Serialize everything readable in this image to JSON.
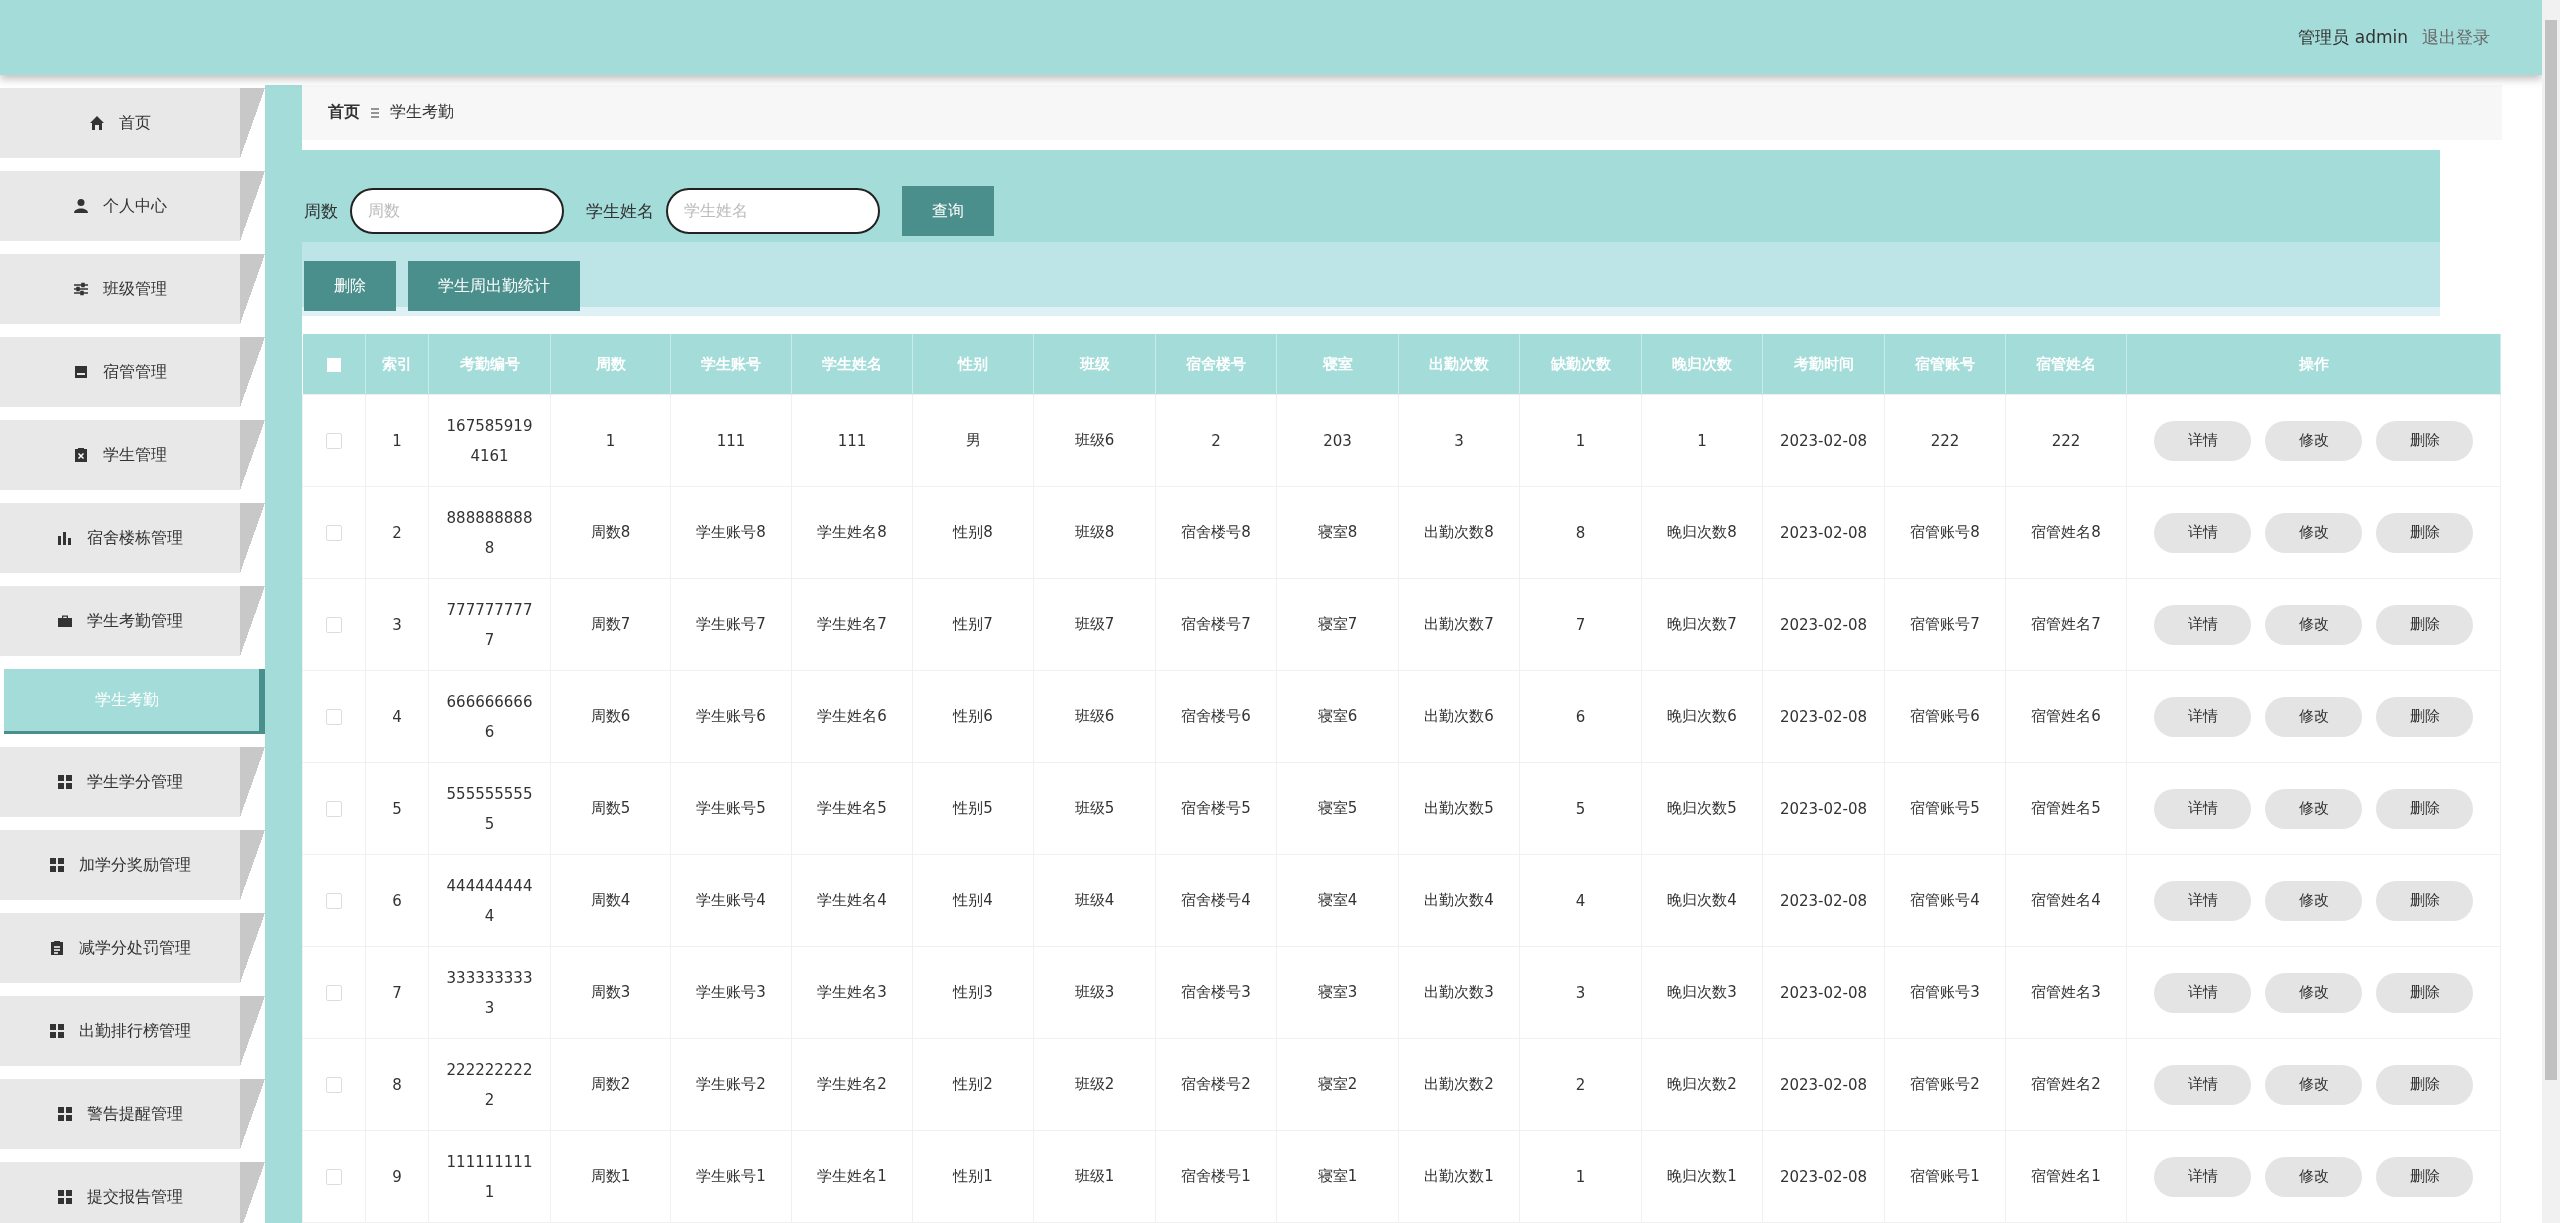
{
  "header": {
    "user": "管理员 admin",
    "logout": "退出登录"
  },
  "sidebar": {
    "items": [
      {
        "label": "首页",
        "selected": false
      },
      {
        "label": "个人中心",
        "selected": false
      },
      {
        "label": "班级管理",
        "selected": false
      },
      {
        "label": "宿管管理",
        "selected": false
      },
      {
        "label": "学生管理",
        "selected": false
      },
      {
        "label": "宿舍楼栋管理",
        "selected": false
      },
      {
        "label": "学生考勤管理",
        "selected": false,
        "expanded": true,
        "children": [
          {
            "label": "学生考勤",
            "selected": true
          }
        ]
      },
      {
        "label": "学生学分管理",
        "selected": false
      },
      {
        "label": "加学分奖励管理",
        "selected": false
      },
      {
        "label": "减学分处罚管理",
        "selected": false
      },
      {
        "label": "出勤排行榜管理",
        "selected": false
      },
      {
        "label": "警告提醒管理",
        "selected": false
      },
      {
        "label": "提交报告管理",
        "selected": false
      }
    ]
  },
  "breadcrumb": [
    "首页",
    "学生考勤"
  ],
  "search": {
    "fields": [
      {
        "label": "周数",
        "placeholder": "周数"
      },
      {
        "label": "学生姓名",
        "placeholder": "学生姓名"
      }
    ],
    "button": "查询"
  },
  "actions": [
    "删除",
    "学生周出勤统计"
  ],
  "table": {
    "header_checked": false,
    "columns": [
      "索引",
      "考勤编号",
      "周数",
      "学生账号",
      "学生姓名",
      "性别",
      "班级",
      "宿舍楼号",
      "寝室",
      "出勤次数",
      "缺勤次数",
      "晚归次数",
      "考勤时间",
      "宿管账号",
      "宿管姓名",
      "操作"
    ],
    "rows": [
      {
        "checked": false,
        "cells": [
          "1",
          "1675859194161",
          "1",
          "111",
          "111",
          "男",
          "班级6",
          "2",
          "203",
          "3",
          "1",
          "1",
          "2023-02-08",
          "222",
          "222"
        ],
        "buttons": [
          "详情",
          "修改",
          "删除"
        ]
      },
      {
        "checked": false,
        "cells": [
          "2",
          "8888888888",
          "周数8",
          "学生账号8",
          "学生姓名8",
          "性别8",
          "班级8",
          "宿舍楼号8",
          "寝室8",
          "出勤次数8",
          "8",
          "晚归次数8",
          "2023-02-08",
          "宿管账号8",
          "宿管姓名8"
        ],
        "buttons": [
          "详情",
          "修改",
          "删除"
        ]
      },
      {
        "checked": false,
        "cells": [
          "3",
          "7777777777",
          "周数7",
          "学生账号7",
          "学生姓名7",
          "性别7",
          "班级7",
          "宿舍楼号7",
          "寝室7",
          "出勤次数7",
          "7",
          "晚归次数7",
          "2023-02-08",
          "宿管账号7",
          "宿管姓名7"
        ],
        "buttons": [
          "详情",
          "修改",
          "删除"
        ]
      },
      {
        "checked": false,
        "cells": [
          "4",
          "6666666666",
          "周数6",
          "学生账号6",
          "学生姓名6",
          "性别6",
          "班级6",
          "宿舍楼号6",
          "寝室6",
          "出勤次数6",
          "6",
          "晚归次数6",
          "2023-02-08",
          "宿管账号6",
          "宿管姓名6"
        ],
        "buttons": [
          "详情",
          "修改",
          "删除"
        ]
      },
      {
        "checked": false,
        "cells": [
          "5",
          "5555555555",
          "周数5",
          "学生账号5",
          "学生姓名5",
          "性别5",
          "班级5",
          "宿舍楼号5",
          "寝室5",
          "出勤次数5",
          "5",
          "晚归次数5",
          "2023-02-08",
          "宿管账号5",
          "宿管姓名5"
        ],
        "buttons": [
          "详情",
          "修改",
          "删除"
        ]
      },
      {
        "checked": false,
        "cells": [
          "6",
          "4444444444",
          "周数4",
          "学生账号4",
          "学生姓名4",
          "性别4",
          "班级4",
          "宿舍楼号4",
          "寝室4",
          "出勤次数4",
          "4",
          "晚归次数4",
          "2023-02-08",
          "宿管账号4",
          "宿管姓名4"
        ],
        "buttons": [
          "详情",
          "修改",
          "删除"
        ]
      },
      {
        "checked": false,
        "cells": [
          "7",
          "3333333333",
          "周数3",
          "学生账号3",
          "学生姓名3",
          "性别3",
          "班级3",
          "宿舍楼号3",
          "寝室3",
          "出勤次数3",
          "3",
          "晚归次数3",
          "2023-02-08",
          "宿管账号3",
          "宿管姓名3"
        ],
        "buttons": [
          "详情",
          "修改",
          "删除"
        ]
      },
      {
        "checked": false,
        "cells": [
          "8",
          "2222222222",
          "周数2",
          "学生账号2",
          "学生姓名2",
          "性别2",
          "班级2",
          "宿舍楼号2",
          "寝室2",
          "出勤次数2",
          "2",
          "晚归次数2",
          "2023-02-08",
          "宿管账号2",
          "宿管姓名2"
        ],
        "buttons": [
          "详情",
          "修改",
          "删除"
        ]
      },
      {
        "checked": false,
        "cells": [
          "9",
          "1111111111",
          "周数1",
          "学生账号1",
          "学生姓名1",
          "性别1",
          "班级1",
          "宿舍楼号1",
          "寝室1",
          "出勤次数1",
          "1",
          "晚归次数1",
          "2023-02-08",
          "宿管账号1",
          "宿管姓名1"
        ],
        "buttons": [
          "详情",
          "修改",
          "删除"
        ]
      }
    ]
  }
}
